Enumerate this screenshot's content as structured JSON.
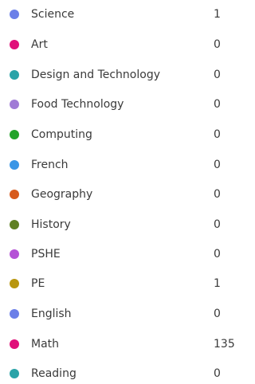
{
  "subjects": [
    {
      "label": "Science",
      "count": "1",
      "color": "#6b7fe8"
    },
    {
      "label": "Art",
      "count": "0",
      "color": "#e0107a"
    },
    {
      "label": "Design and Technology",
      "count": "0",
      "color": "#2aa3a8"
    },
    {
      "label": "Food Technology",
      "count": "0",
      "color": "#a07bd6"
    },
    {
      "label": "Computing",
      "count": "0",
      "color": "#22a32a"
    },
    {
      "label": "French",
      "count": "0",
      "color": "#3a96e6"
    },
    {
      "label": "Geography",
      "count": "0",
      "color": "#d75a1c"
    },
    {
      "label": "History",
      "count": "0",
      "color": "#5f7f22"
    },
    {
      "label": "PSHE",
      "count": "0",
      "color": "#b552d6"
    },
    {
      "label": "PE",
      "count": "1",
      "color": "#b8960f"
    },
    {
      "label": "English",
      "count": "0",
      "color": "#6b7fe8"
    },
    {
      "label": "Math",
      "count": "135",
      "color": "#e0107a"
    },
    {
      "label": "Reading",
      "count": "0",
      "color": "#2aa3a8"
    }
  ]
}
